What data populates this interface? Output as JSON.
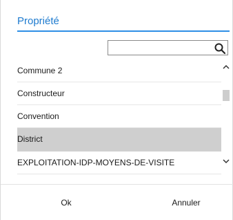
{
  "dialog": {
    "title": "Propriété",
    "accent_color": "#2e8fe6"
  },
  "search": {
    "value": "",
    "placeholder": "",
    "icon": "search-icon"
  },
  "list": {
    "items": [
      {
        "label": "Commune 2",
        "selected": false
      },
      {
        "label": "Constructeur",
        "selected": false
      },
      {
        "label": "Convention",
        "selected": false
      },
      {
        "label": "District",
        "selected": true
      },
      {
        "label": "EXPLOITATION-IDP-MOYENS-DE-VISITE",
        "selected": false
      }
    ],
    "selected_color": "#cfcfcf"
  },
  "footer": {
    "ok_label": "Ok",
    "cancel_label": "Annuler"
  }
}
